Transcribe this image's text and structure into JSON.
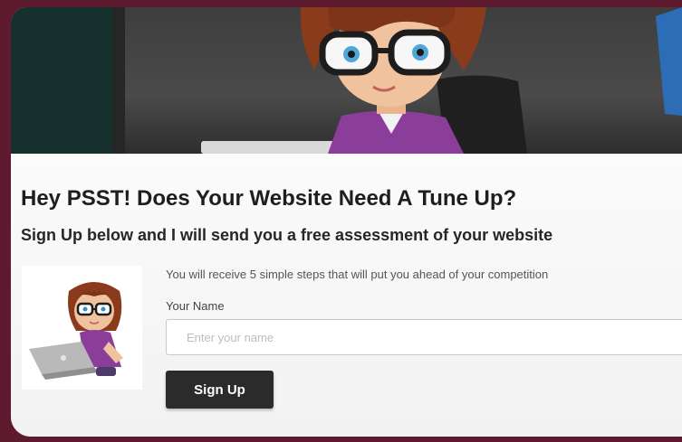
{
  "colors": {
    "frame": "#5e1a2e",
    "button": "#2b2b2b",
    "hair": "#8a3b1c",
    "shirt": "#8a3e9a"
  },
  "hero": {
    "image": "cartoon-woman-with-glasses-at-desk"
  },
  "optin": {
    "headline": "Hey PSST! Does Your Website Need A Tune Up?",
    "subheadline": "Sign Up below and I will send you a free assessment of your website",
    "description": "You will receive  5 simple steps that will put you ahead of your competition",
    "thumbnail": "cartoon-woman-with-laptop",
    "name_label": "Your Name",
    "name_placeholder": "Enter your name",
    "name_value": "",
    "submit_label": "Sign Up"
  }
}
